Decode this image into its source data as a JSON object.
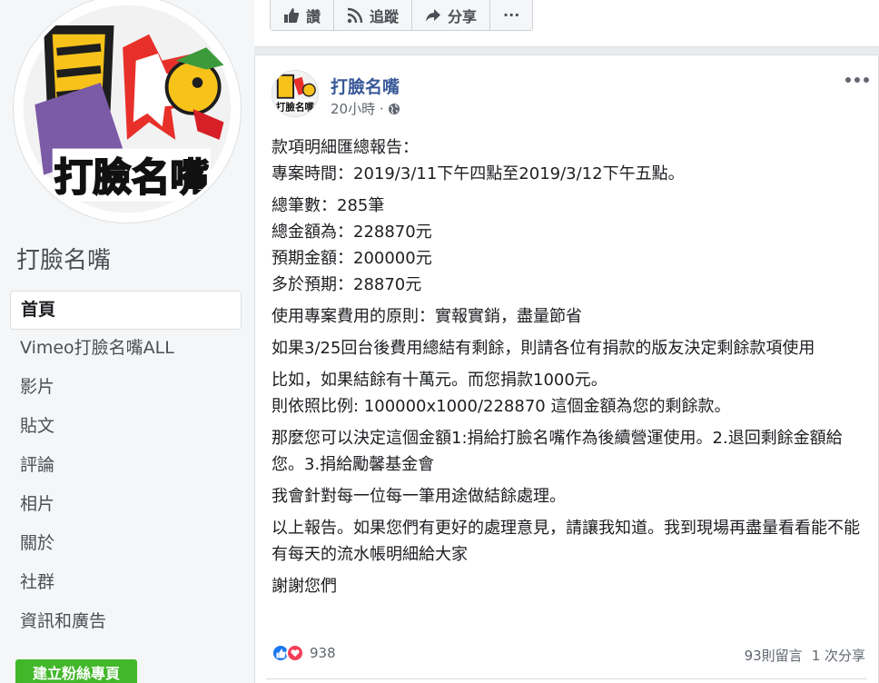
{
  "sidebar": {
    "page_name": "打臉名嘴",
    "items": [
      {
        "label": "首頁"
      },
      {
        "label": "Vimeo打臉名嘴ALL"
      },
      {
        "label": "影片"
      },
      {
        "label": "貼文"
      },
      {
        "label": "評論"
      },
      {
        "label": "相片"
      },
      {
        "label": "關於"
      },
      {
        "label": "社群"
      },
      {
        "label": "資訊和廣告"
      }
    ],
    "create_button": "建立粉絲專頁"
  },
  "action_bar": {
    "like": "讚",
    "follow": "追蹤",
    "share": "分享",
    "more": "···"
  },
  "post": {
    "author": "打臉名嘴",
    "time": "20小時 ·",
    "paragraphs": [
      "款項明細匯總報告：\n專案時間：2019/3/11下午四點至2019/3/12下午五點。",
      "總筆數：285筆\n總金額為：228870元\n預期金額：200000元\n多於預期：28870元",
      "使用專案費用的原則：實報實銷，盡量節省",
      "如果3/25回台後費用總結有剩餘，則請各位有捐款的版友決定剩餘款項使用",
      "比如，如果結餘有十萬元。而您捐款1000元。\n則依照比例: 100000x1000/228870 這個金額為您的剩餘款。",
      "那麼您可以決定這個金額1:捐給打臉名嘴作為後續營運使用。2.退回剩餘金額給您。3.捐給勵馨基金會",
      "我會針對每一位每一筆用途做結餘處理。",
      "以上報告。如果您們有更好的處理意見，請讓我知道。我到現場再盡量看看能不能有每天的流水帳明細給大家",
      "謝謝您們"
    ],
    "reaction_count": "938",
    "comments": "93則留言",
    "shares": "1 次分享"
  },
  "colors": {
    "link_blue": "#385898",
    "green_button": "#42b72a",
    "like_blue": "#1877f2",
    "love_red": "#f33e58"
  },
  "icons": [
    "thumbs-up-icon",
    "rss-icon",
    "share-arrow-icon",
    "globe-icon",
    "more-dots-icon"
  ]
}
